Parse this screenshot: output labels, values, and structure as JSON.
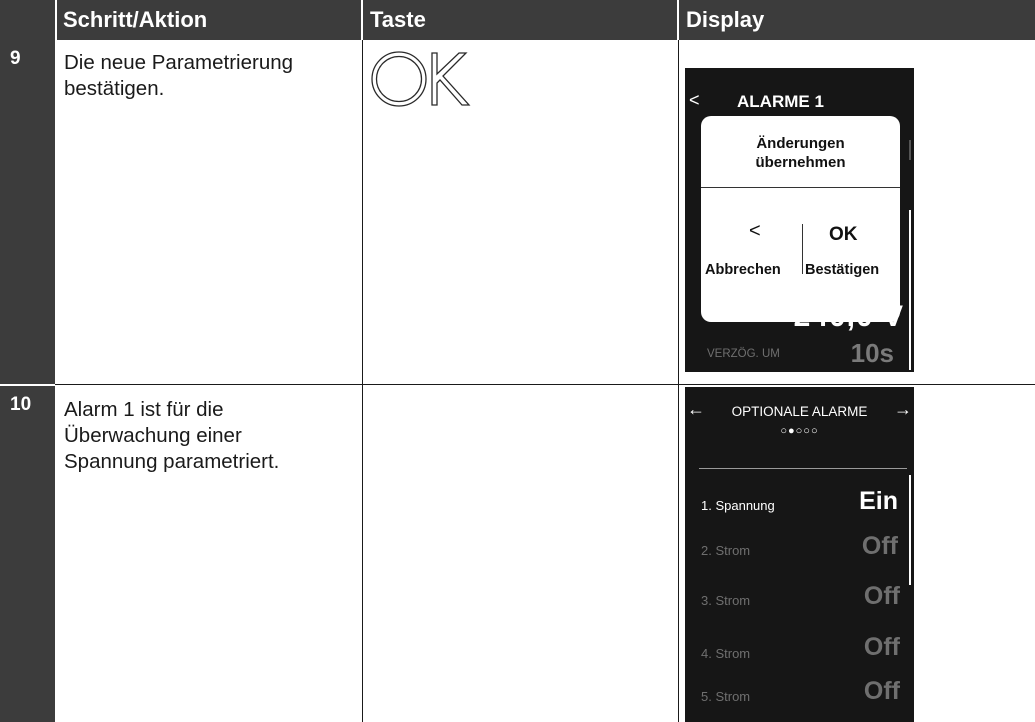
{
  "header": {
    "col_step": "Schritt/Aktion",
    "col_key": "Taste",
    "col_display": "Display"
  },
  "rows": [
    {
      "number": "9",
      "action_lines": [
        "Die neue Parametrierung",
        "bestätigen."
      ],
      "key_label": "OK",
      "display": {
        "back_glyph": "<",
        "title": "ALARME 1",
        "popup": {
          "title_line1": "Änderungen",
          "title_line2": "übernehmen",
          "left_glyph": "<",
          "right_label": "OK",
          "cancel_label": "Abbrechen",
          "confirm_label": "Bestätigen"
        },
        "big_value": "240,0 V",
        "delay_label": "VERZÖG. UM",
        "delay_value": "10s"
      }
    },
    {
      "number": "10",
      "action_lines": [
        "Alarm 1 ist für die",
        "Überwachung einer",
        "Spannung parametriert."
      ],
      "display": {
        "left_arrow": "←",
        "right_arrow": "→",
        "title": "OPTIONALE ALARME",
        "page_dots": "○●○○○",
        "items": [
          {
            "label": "1. Spannung",
            "value": "Ein",
            "active": true
          },
          {
            "label": "2. Strom",
            "value": "Off",
            "active": false
          },
          {
            "label": "3. Strom",
            "value": "Off",
            "active": false
          },
          {
            "label": "4. Strom",
            "value": "Off",
            "active": false
          },
          {
            "label": "5. Strom",
            "value": "Off",
            "active": false
          }
        ]
      }
    }
  ],
  "colors": {
    "header_bg": "#3c3c3c",
    "display_bg": "#161616",
    "inactive_text": "#6f6f6f"
  }
}
